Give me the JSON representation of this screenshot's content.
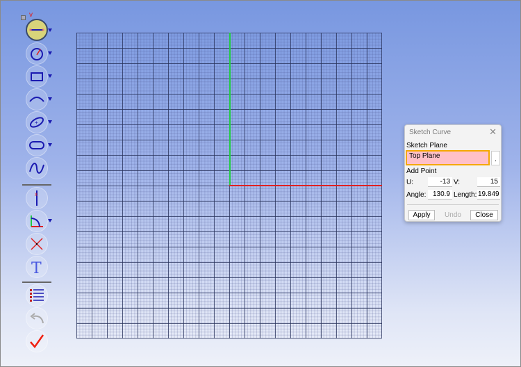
{
  "toolbar": {
    "collapse_icon": "collapse-box-icon",
    "tools": [
      "line",
      "circle",
      "rectangle",
      "arc",
      "ellipse",
      "slot",
      "spline",
      "point-on-curve",
      "angle-dimension",
      "delete-point",
      "text",
      "list",
      "undo",
      "done"
    ]
  },
  "axis_colors": {
    "x": "#e0202a",
    "y": "#22cc44"
  },
  "dialog": {
    "title": "Sketch Curve",
    "sketch_plane_label": "Sketch Plane",
    "sketch_plane_value": "Top Plane",
    "browse_label": ".",
    "add_point_label": "Add Point",
    "u_label": "U:",
    "u_value": "-13",
    "v_label": "V:",
    "v_value": "15",
    "angle_label": "Angle:",
    "angle_value": "130.9",
    "length_label": "Length:",
    "length_value": "19.849",
    "apply": "Apply",
    "undo": "Undo",
    "close": "Close"
  }
}
